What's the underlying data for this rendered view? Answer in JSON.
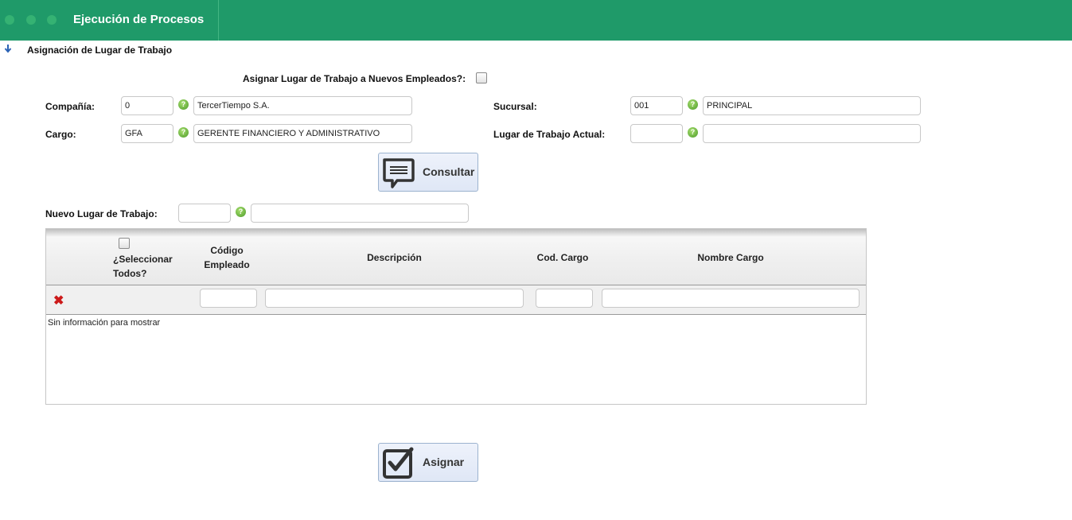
{
  "header": {
    "title": "Ejecución de Procesos"
  },
  "breadcrumb": {
    "label": "Asignación de Lugar de Trabajo"
  },
  "form": {
    "asignar_nuevos_label": "Asignar Lugar de Trabajo a Nuevos Empleados?:",
    "compania": {
      "label": "Compañía:",
      "code": "0",
      "name": "TercerTiempo S.A."
    },
    "cargo": {
      "label": "Cargo:",
      "code": "GFA",
      "name": "GERENTE FINANCIERO Y ADMINISTRATIVO"
    },
    "sucursal": {
      "label": "Sucursal:",
      "code": "001",
      "name": "PRINCIPAL"
    },
    "lugar_actual": {
      "label": "Lugar de Trabajo Actual:",
      "code": "",
      "name": ""
    },
    "nuevo_lugar": {
      "label": "Nuevo Lugar de Trabajo:",
      "code": "",
      "name": ""
    },
    "help_glyph": "?"
  },
  "buttons": {
    "consultar": "Consultar",
    "asignar": "Asignar"
  },
  "grid": {
    "columns": {
      "seleccionar": "¿Seleccionar Todos?",
      "codigo": "Código Empleado",
      "descripcion": "Descripción",
      "cod_cargo": "Cod. Cargo",
      "nombre_cargo": "Nombre Cargo"
    },
    "clear_icon": "✖",
    "empty_text": "Sin información para mostrar"
  },
  "colors": {
    "header_bg": "#1f9a69",
    "button_bg": "#e6ecf8",
    "help_icon": "#5aa832",
    "clear_icon": "#cc1a1a"
  }
}
